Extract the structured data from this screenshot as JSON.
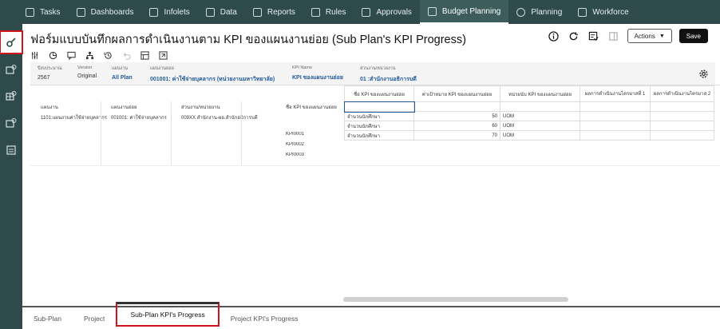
{
  "topnav": {
    "items": [
      {
        "label": "Tasks",
        "icon": "tasks-icon"
      },
      {
        "label": "Dashboards",
        "icon": "dashboards-icon"
      },
      {
        "label": "Infolets",
        "icon": "infolets-icon"
      },
      {
        "label": "Data",
        "icon": "data-icon"
      },
      {
        "label": "Reports",
        "icon": "reports-icon"
      },
      {
        "label": "Rules",
        "icon": "rules-icon"
      },
      {
        "label": "Approvals",
        "icon": "approvals-icon"
      },
      {
        "label": "Budget Planning",
        "icon": "budget-planning-icon",
        "active": true
      },
      {
        "label": "Planning",
        "icon": "planning-icon"
      },
      {
        "label": "Workforce",
        "icon": "workforce-icon"
      }
    ]
  },
  "page": {
    "title": "ฟอร์มแบบบันทึกผลการดำเนินงานตาม KPI ของแผนงานย่อย (Sub Plan's KPI Progress)",
    "actions_label": "Actions",
    "save_label": "Save"
  },
  "pov": [
    {
      "label": "ปีงบประมาณ",
      "value": "2567",
      "link": false
    },
    {
      "label": "Version",
      "value": "Original",
      "link": false
    },
    {
      "label": "แผนงาน",
      "value": "All Plan",
      "link": true
    },
    {
      "label": "แผนงานย่อย",
      "value": "001001: ค่าใช้จ่ายบุคลากร (หน่วยงานมหาวิทยาลัย)",
      "link": true
    },
    {
      "label": "KPI Name",
      "value": "KPI ของแผนงานย่อย",
      "link": true
    },
    {
      "label": "ส่วนงาน/หน่วยงาน",
      "value": "01 :สำนักงานอธิการบดี",
      "link": true
    }
  ],
  "grid": {
    "row_headers": [
      "แผนงาน",
      "แผนงานย่อย",
      "ส่วนงาน/หน่วยงาน",
      "ชื่อ KPI ของแผนงานย่อย"
    ],
    "row_values": [
      "1101:แผนงานค่าใช้จ่ายบุคลากร",
      "001001: ค่าใช้จ่ายบุคลากร",
      "009XX สำนักงาน-ผอ.สำนักอธิการบดี"
    ],
    "columns": [
      "ชื่อ KPI ของแผนงานย่อย",
      "ค่าเป้าหมาย KPI ของแผนงานย่อย",
      "หน่วยนับ KPI ของแผนงานย่อย",
      "ผลการดำเนินงานไตรมาสที่ 1",
      "ผลการดำเนินงานไตรมาส 2"
    ],
    "rows": [
      {
        "kpi": "KPI0001",
        "name": "จำนวนนักศึกษา",
        "target": "50",
        "unit": "UOM"
      },
      {
        "kpi": "KPI0002",
        "name": "จำนวนนักศึกษา",
        "target": "60",
        "unit": "UOM"
      },
      {
        "kpi": "KPI0003",
        "name": "จำนวนนักศึกษา",
        "target": "70",
        "unit": "UOM"
      }
    ]
  },
  "tabs": [
    {
      "label": "Sub-Plan"
    },
    {
      "label": "Project"
    },
    {
      "label": "Sub-Plan KPI's Progress",
      "active": true
    },
    {
      "label": "Project KPI's Progress"
    }
  ]
}
